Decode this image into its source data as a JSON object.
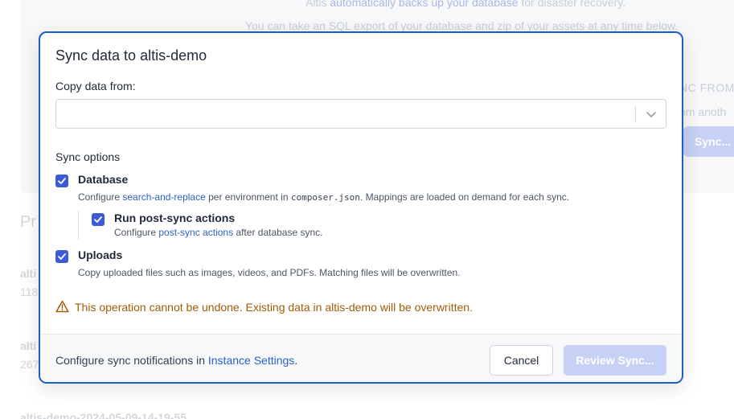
{
  "background": {
    "backup_prefix": "Altis ",
    "backup_link": "automatically backs up your database",
    "backup_suffix": " for disaster recovery.",
    "export_text": "You can take an SQL export of your database and zip of your assets at any time below.",
    "sync_from": "NC FROM",
    "from_another": "om anoth",
    "sync_button": "Sync...",
    "heading": "Pr",
    "items": [
      {
        "title": "alti",
        "sub": "118"
      },
      {
        "title": "alti",
        "sub": "267"
      },
      {
        "title": "altis-demo-2024-05-09-14-19-55",
        "sub": ""
      }
    ]
  },
  "modal": {
    "title": "Sync data to altis-demo",
    "copy_from_label": "Copy data from:",
    "copy_from_value": "",
    "sync_options_label": "Sync options",
    "options": {
      "database": {
        "label": "Database",
        "checked": true,
        "desc_prefix": "Configure ",
        "desc_link": "search-and-replace",
        "desc_mid": " per environment in ",
        "desc_code": "composer.json",
        "desc_suffix": ". Mappings are loaded on demand for each sync."
      },
      "post_sync": {
        "label": "Run post-sync actions",
        "checked": true,
        "desc_prefix": "Configure ",
        "desc_link": "post-sync actions",
        "desc_suffix": " after database sync."
      },
      "uploads": {
        "label": "Uploads",
        "checked": true,
        "desc": "Copy uploaded files such as images, videos, and PDFs. Matching files will be overwritten."
      }
    },
    "warning": "This operation cannot be undone. Existing data in altis-demo will be overwritten.",
    "footer": {
      "text_prefix": "Configure sync notifications in ",
      "link": "Instance Settings",
      "text_suffix": ".",
      "cancel_label": "Cancel",
      "review_label": "Review Sync..."
    }
  },
  "colors": {
    "accent": "#3b5bdb",
    "modal_border": "#1d5fc4",
    "link": "#2b5fc7",
    "warning": "#a15c07",
    "disabled_button": "#c7d0f5"
  },
  "icons": {
    "select_arrow": "chevron-down-icon",
    "checkbox": "check-icon",
    "warning": "warning-triangle-icon"
  }
}
